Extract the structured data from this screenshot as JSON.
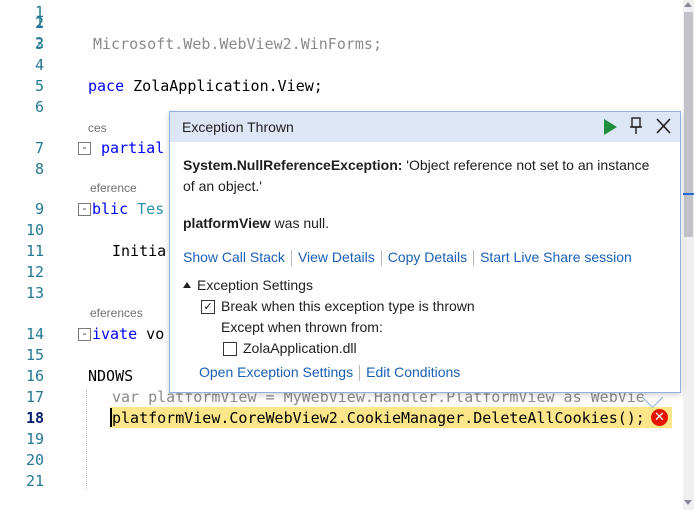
{
  "editor": {
    "line_numbers": [
      "1",
      "2",
      "3",
      "4",
      "5",
      "6",
      "7",
      "8",
      "9",
      "10",
      "11",
      "12",
      "13",
      "14",
      "15",
      "16",
      "17",
      "18",
      "19",
      "20",
      "21"
    ],
    "current_line": "18",
    "lines": {
      "l3": "Microsoft.Web.WebView2.WinForms;",
      "l5_kw": "pace",
      "l5_rest": " ZolaApplication.View;",
      "l7_fold": "-",
      "l7": " partial",
      "l9_kw": "blic",
      "l9_type": " Tes",
      "l11": "Initia",
      "l14_kw": "ivate",
      "l14_rest": " vo",
      "l16": "NDOWS",
      "l17": "var platformView = MyWebView.Handler.PlatformView as WebView",
      "l18": "platformView.CoreWebView2.CookieManager.DeleteAllCookies();"
    },
    "codelens": {
      "refs_7": "ces",
      "refs_9": "eference",
      "refs_14": "eferences"
    }
  },
  "popup": {
    "title": "Exception Thrown",
    "exception_type": "System.NullReferenceException:",
    "exception_message": " 'Object reference not set to an instance of an object.'",
    "null_var": "platformView",
    "null_suffix": " was null.",
    "links": {
      "show_call_stack": "Show Call Stack",
      "view_details": "View Details",
      "copy_details": "Copy Details",
      "live_share": "Start Live Share session"
    },
    "settings": {
      "header": "Exception Settings",
      "break_when": "Break when this exception type is thrown",
      "break_checked": "✓",
      "except_when": "Except when thrown from:",
      "module": "ZolaApplication.dll",
      "open_settings": "Open Exception Settings",
      "edit_conditions": "Edit Conditions"
    }
  },
  "icons": {
    "error": "✕"
  },
  "colors": {
    "header_bg": "#dce6f4",
    "link": "#1a5fb4",
    "continue_green": "#1e8e3e",
    "error_red": "#e51400",
    "highlight": "#fde68a"
  }
}
